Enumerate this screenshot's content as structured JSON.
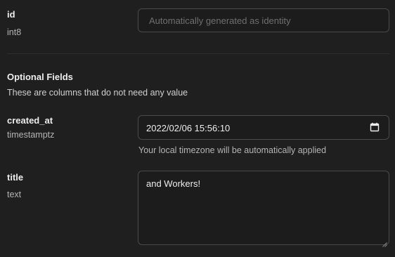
{
  "fields": {
    "id": {
      "name": "id",
      "type": "int8",
      "placeholder": "Automatically generated as identity"
    },
    "created_at": {
      "name": "created_at",
      "type": "timestamptz",
      "value": "2022/02/06 15:56:10",
      "hint": "Your local timezone will be automatically applied",
      "icon": "calendar-icon"
    },
    "title": {
      "name": "title",
      "type": "text",
      "value": "and Workers!"
    }
  },
  "optional_section": {
    "heading": "Optional Fields",
    "description": "These are columns that do not need any value"
  }
}
